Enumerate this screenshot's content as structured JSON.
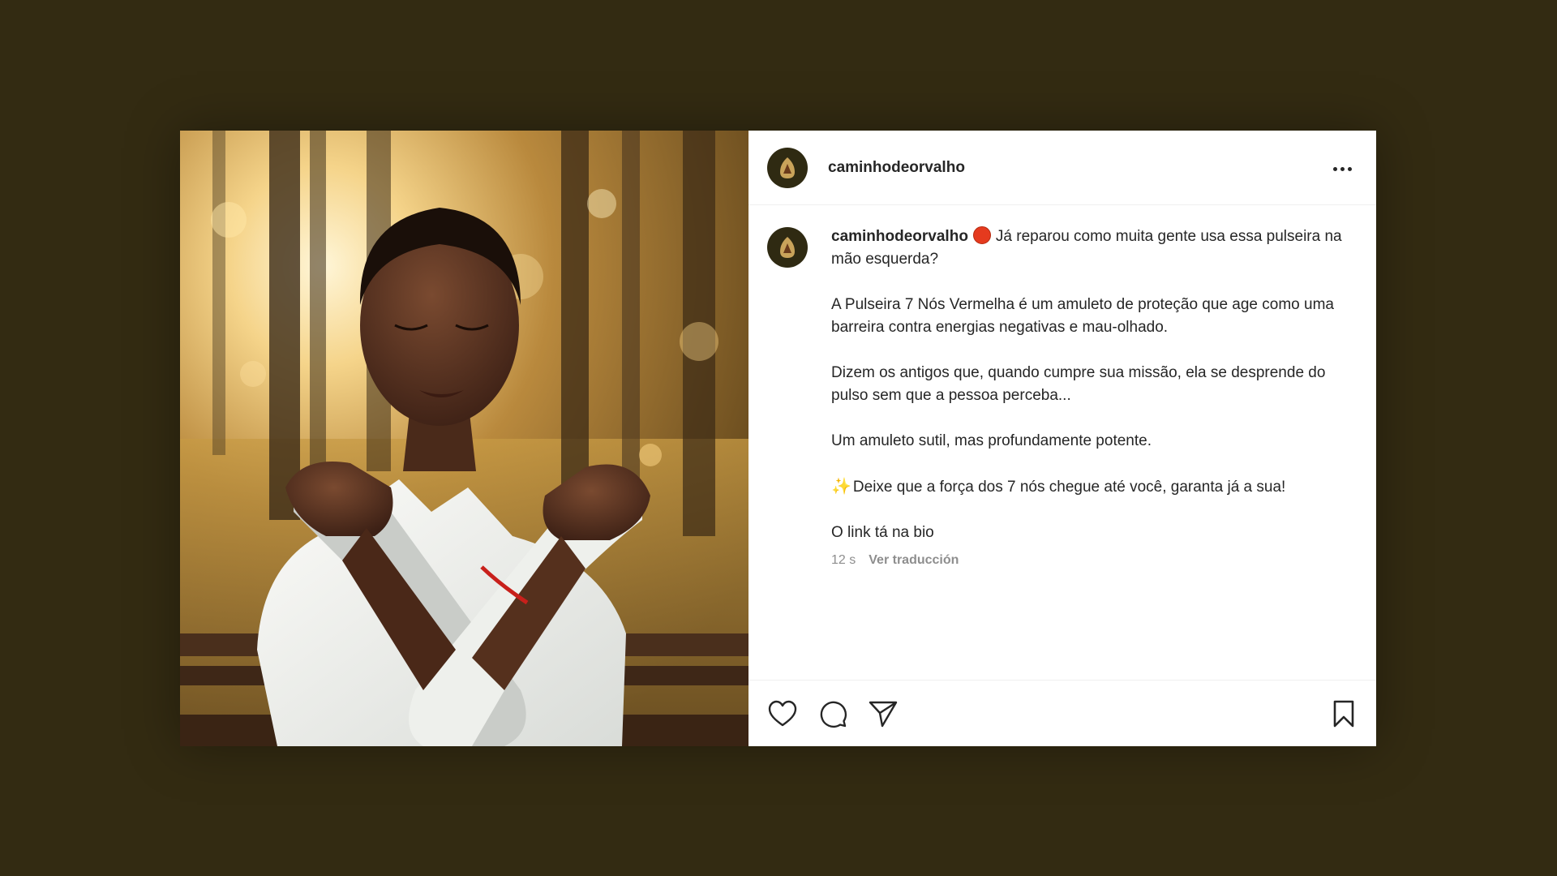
{
  "post": {
    "username": "caminhodeorvalho",
    "caption": {
      "username": "caminhodeorvalho",
      "first_line": "Já reparou como muita gente usa essa pulseira na mão esquerda?",
      "paragraphs": [
        "A Pulseira 7 Nós Vermelha é um amuleto de proteção que age como uma barreira contra energias negativas e mau-olhado.",
        "Dizem os antigos que, quando cumpre sua missão, ela se desprende do pulso sem que a pessoa perceba...",
        "Um amuleto sutil, mas profundamente potente."
      ],
      "sparkle_line": "Deixe que a força dos 7 nós chegue até você, garanta já a sua!",
      "last_line": "O link tá na bio"
    },
    "timestamp": "12 s",
    "translate_label": "Ver traducción"
  },
  "icons": {
    "more": "more-options-icon",
    "like": "heart-icon",
    "comment": "comment-icon",
    "share": "send-icon",
    "save": "bookmark-icon",
    "emoji_red": "red-circle-emoji",
    "emoji_sparkle": "sparkles-emoji"
  },
  "colors": {
    "backdrop": "#332b12",
    "text": "#262626",
    "secondary_text": "#8e8e8e",
    "red_circle": "#e53a1e"
  }
}
